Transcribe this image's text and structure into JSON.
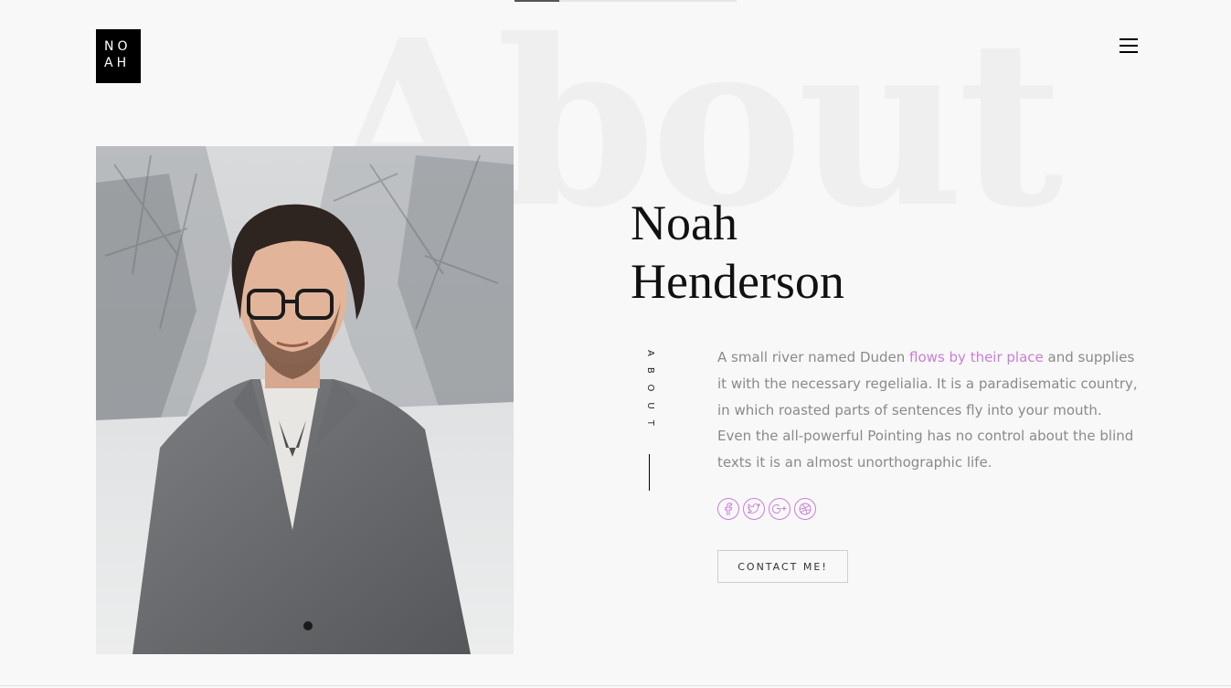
{
  "header": {
    "logo_line1": "NO",
    "logo_line2": "AH",
    "menu_icon": "hamburger-menu-icon"
  },
  "scroll_progress": 0.2,
  "background_word": "About",
  "profile": {
    "photo_subject": "portrait-photo",
    "first_name": "Noah",
    "last_name": "Henderson"
  },
  "about": {
    "side_label": "ABOUT",
    "bio_before_link": "A small river named Duden ",
    "bio_link": "flows by their place",
    "bio_after_link": " and supplies it with the necessary regelialia. It is a paradisematic country, in which roasted parts of sentences fly into your mouth. Even the all-powerful Pointing has no control about the blind texts it is an almost unorthographic life."
  },
  "social_icons": [
    "facebook-icon",
    "twitter-icon",
    "google-plus-icon",
    "dribbble-icon"
  ],
  "contact_button": "CONTACT ME!",
  "colors": {
    "accent": "#c97ed8",
    "background": "#f8f8f8",
    "logo_bg": "#000000"
  }
}
